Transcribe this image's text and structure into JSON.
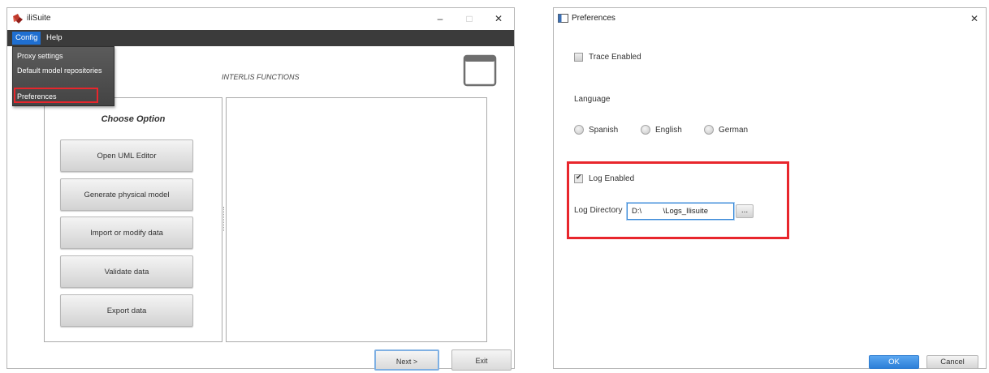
{
  "left_window": {
    "title": "iliSuite",
    "controls": {
      "minimize": "–",
      "maximize": "□",
      "close": "✕"
    },
    "menu": [
      {
        "label": "Config"
      },
      {
        "label": "Help"
      }
    ],
    "dropdown": [
      {
        "label": "Proxy settings"
      },
      {
        "label": "Default model repositories"
      },
      {
        "label": "Preferences"
      }
    ],
    "header": "INTERLIS FUNCTIONS",
    "choose_title": "Choose Option",
    "options": [
      {
        "label": "Open UML Editor"
      },
      {
        "label": "Generate physical model"
      },
      {
        "label": "Import or modify data"
      },
      {
        "label": "Validate data"
      },
      {
        "label": "Export data"
      }
    ],
    "next_label": "Next >",
    "exit_label": "Exit"
  },
  "right_window": {
    "title": "Preferences",
    "close": "✕",
    "trace_label": "Trace Enabled",
    "language_label": "Language",
    "languages": [
      {
        "label": "Spanish"
      },
      {
        "label": "English"
      },
      {
        "label": "German"
      }
    ],
    "log_enabled_label": "Log Enabled",
    "check_mark": "✔",
    "log_directory_label": "Log Directory",
    "log_directory_value": "D:\\          \\Logs_Ilisuite",
    "browse_label": "...",
    "ok_label": "OK",
    "cancel_label": "Cancel"
  },
  "colors": {
    "highlight": "#e8262c",
    "accent": "#1f6fd1",
    "menubar": "#3b3b3b"
  }
}
